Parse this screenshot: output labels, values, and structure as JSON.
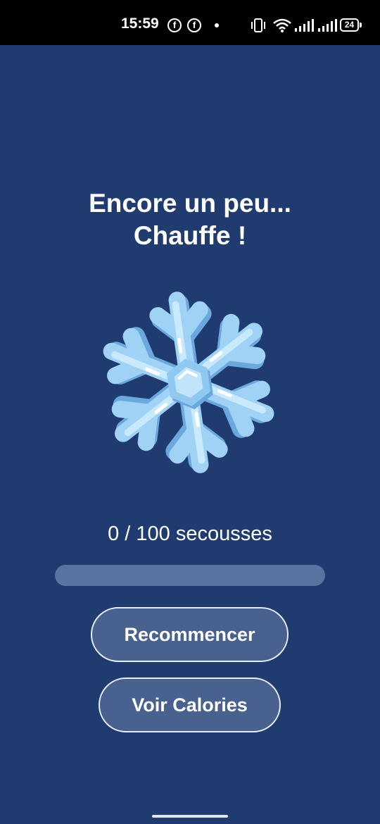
{
  "status_bar": {
    "time": "15:59",
    "notification_icons": [
      "facebook-icon",
      "facebook-icon"
    ],
    "battery_level": "24"
  },
  "title": {
    "line1": "Encore un peu...",
    "line2": "Chauffe !"
  },
  "illustration": {
    "icon": "snowflake-icon",
    "colors": {
      "light": "#bfe4fb",
      "mid": "#8fc9f1",
      "dark": "#6aa8de"
    }
  },
  "progress": {
    "label": "0 / 100 secousses",
    "current": 0,
    "target": 100,
    "fraction": 0
  },
  "buttons": {
    "restart_label": "Recommencer",
    "calories_label": "Voir Calories"
  },
  "theme": {
    "background": "#1f3b70",
    "button_fill": "#48618f",
    "track": "#5a72a0"
  }
}
